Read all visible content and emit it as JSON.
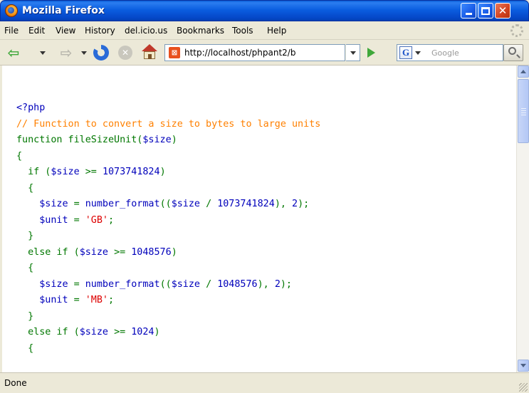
{
  "window": {
    "title": "Mozilla Firefox",
    "controls": {
      "minimize": "minimize",
      "maximize": "maximize",
      "close": "close"
    }
  },
  "menubar": {
    "items": [
      "File",
      "Edit",
      "View",
      "History",
      "del.icio.us",
      "Bookmarks",
      "Tools",
      "Help"
    ]
  },
  "navbar": {
    "url": "http://localhost/phpant2/b",
    "search_engine": "Google",
    "search_placeholder": "Google"
  },
  "code": {
    "lines": [
      [
        {
          "t": "<?php",
          "c": "c-var"
        }
      ],
      [
        {
          "t": "// Function to convert a size to bytes to large units",
          "c": "c-comment"
        }
      ],
      [
        {
          "t": "function fileSizeUnit(",
          "c": "c-def"
        },
        {
          "t": "$size",
          "c": "c-var"
        },
        {
          "t": ")",
          "c": "c-def"
        }
      ],
      [
        {
          "t": "{",
          "c": "c-def"
        }
      ],
      [
        {
          "t": "  if (",
          "c": "c-def"
        },
        {
          "t": "$size ",
          "c": "c-var"
        },
        {
          "t": ">= ",
          "c": "c-def"
        },
        {
          "t": "1073741824",
          "c": "c-var"
        },
        {
          "t": ")",
          "c": "c-def"
        }
      ],
      [
        {
          "t": "  {",
          "c": "c-def"
        }
      ],
      [
        {
          "t": "    $size ",
          "c": "c-var"
        },
        {
          "t": "= ",
          "c": "c-def"
        },
        {
          "t": "number_format",
          "c": "c-var"
        },
        {
          "t": "((",
          "c": "c-def"
        },
        {
          "t": "$size ",
          "c": "c-var"
        },
        {
          "t": "/ ",
          "c": "c-def"
        },
        {
          "t": "1073741824",
          "c": "c-var"
        },
        {
          "t": "), ",
          "c": "c-def"
        },
        {
          "t": "2",
          "c": "c-var"
        },
        {
          "t": ");",
          "c": "c-def"
        }
      ],
      [
        {
          "t": "    $unit ",
          "c": "c-var"
        },
        {
          "t": "= ",
          "c": "c-def"
        },
        {
          "t": "'GB'",
          "c": "c-str"
        },
        {
          "t": ";",
          "c": "c-def"
        }
      ],
      [
        {
          "t": "  }",
          "c": "c-def"
        }
      ],
      [
        {
          "t": "  else if (",
          "c": "c-def"
        },
        {
          "t": "$size ",
          "c": "c-var"
        },
        {
          "t": ">= ",
          "c": "c-def"
        },
        {
          "t": "1048576",
          "c": "c-var"
        },
        {
          "t": ")",
          "c": "c-def"
        }
      ],
      [
        {
          "t": "  {",
          "c": "c-def"
        }
      ],
      [
        {
          "t": "    $size ",
          "c": "c-var"
        },
        {
          "t": "= ",
          "c": "c-def"
        },
        {
          "t": "number_format",
          "c": "c-var"
        },
        {
          "t": "((",
          "c": "c-def"
        },
        {
          "t": "$size ",
          "c": "c-var"
        },
        {
          "t": "/ ",
          "c": "c-def"
        },
        {
          "t": "1048576",
          "c": "c-var"
        },
        {
          "t": "), ",
          "c": "c-def"
        },
        {
          "t": "2",
          "c": "c-var"
        },
        {
          "t": ");",
          "c": "c-def"
        }
      ],
      [
        {
          "t": "    $unit ",
          "c": "c-var"
        },
        {
          "t": "= ",
          "c": "c-def"
        },
        {
          "t": "'MB'",
          "c": "c-str"
        },
        {
          "t": ";",
          "c": "c-def"
        }
      ],
      [
        {
          "t": "  }",
          "c": "c-def"
        }
      ],
      [
        {
          "t": "  else if (",
          "c": "c-def"
        },
        {
          "t": "$size ",
          "c": "c-var"
        },
        {
          "t": ">= ",
          "c": "c-def"
        },
        {
          "t": "1024",
          "c": "c-var"
        },
        {
          "t": ")",
          "c": "c-def"
        }
      ],
      [
        {
          "t": "  {",
          "c": "c-def"
        }
      ]
    ]
  },
  "statusbar": {
    "text": "Done"
  },
  "colors": {
    "comment": "#ff8000",
    "keyword": "#007700",
    "variable": "#0000bb",
    "string": "#dd0000"
  }
}
